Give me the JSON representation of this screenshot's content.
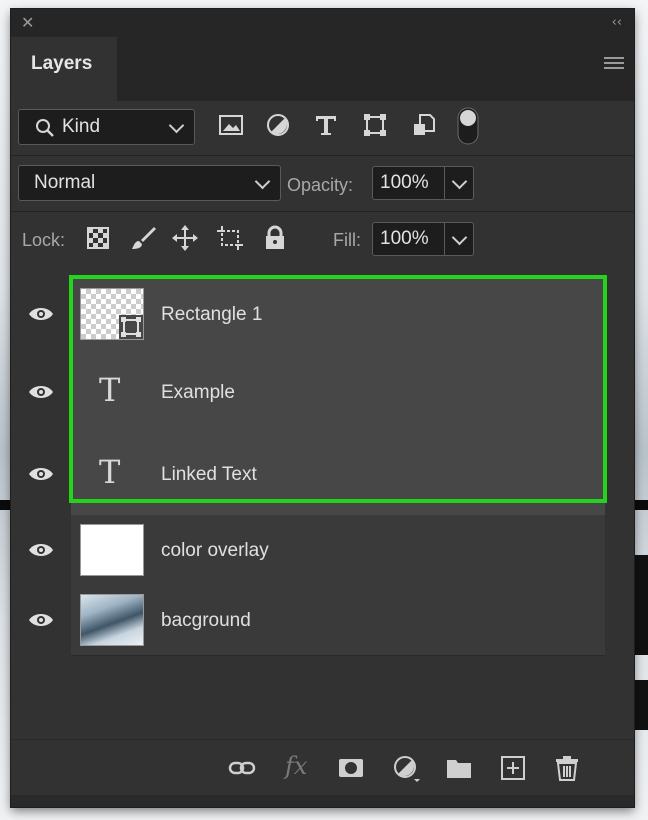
{
  "panel": {
    "tab_label": "Layers",
    "close_glyph": "✕",
    "collapse_glyph": "‹‹"
  },
  "filter": {
    "kind_label": "Kind",
    "icons": [
      "image-filter-icon",
      "adjustment-filter-icon",
      "type-filter-icon",
      "shape-filter-icon",
      "smart-object-filter-icon",
      "filter-toggle-icon"
    ]
  },
  "blend": {
    "mode": "Normal",
    "opacity_label": "Opacity:",
    "opacity_value": "100%"
  },
  "lock": {
    "label": "Lock:",
    "icons": [
      "lock-transparent-icon",
      "lock-image-icon",
      "lock-position-icon",
      "lock-artboard-icon",
      "lock-all-icon"
    ],
    "fill_label": "Fill:",
    "fill_value": "100%"
  },
  "layers": [
    {
      "name": "Rectangle 1",
      "kind": "shape",
      "selected": true
    },
    {
      "name": "Example",
      "kind": "text",
      "selected": true
    },
    {
      "name": "Linked Text",
      "kind": "text",
      "selected": true
    },
    {
      "name": "color overlay",
      "kind": "fill",
      "selected": false
    },
    {
      "name": "bacground",
      "kind": "image",
      "selected": false
    }
  ],
  "footer_icons": [
    "link-layers-icon",
    "fx-icon",
    "add-mask-icon",
    "new-adjustment-icon",
    "new-group-icon",
    "new-layer-icon",
    "delete-icon"
  ],
  "colors": {
    "highlight": "#23d31c",
    "panel_bg": "#323232",
    "selected_row_bg": "#474747"
  }
}
